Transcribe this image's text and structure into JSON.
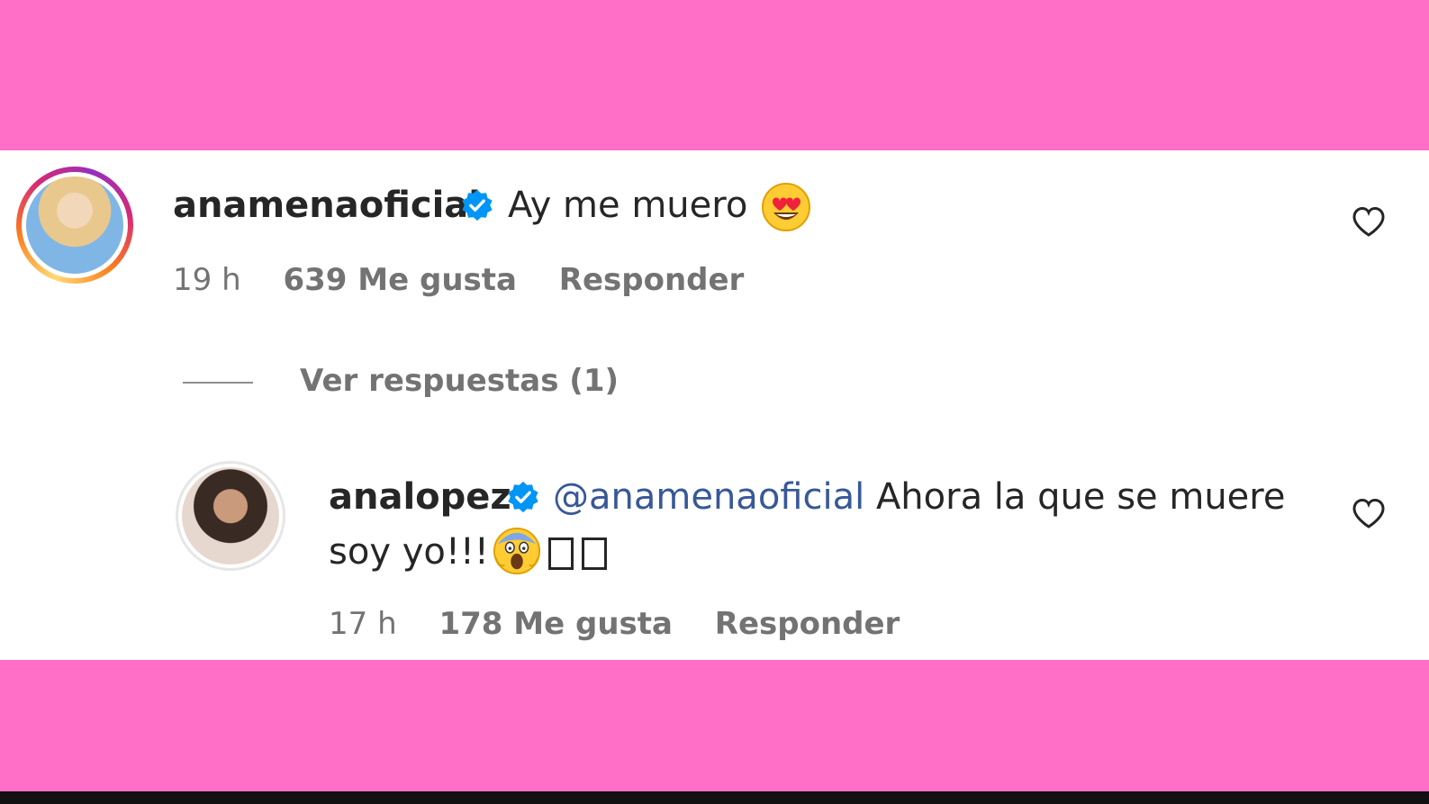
{
  "comments": [
    {
      "username": "anamenaoficial",
      "text": "Ay me muero",
      "emoji": "heart-eyes-emoji",
      "time": "19 h",
      "likes": "639 Me gusta",
      "reply": "Responder"
    },
    {
      "username": "analopez",
      "mention": "@anamenaoficial",
      "text_line1": "Ahora la que se muere",
      "text_line2": "soy yo!!!",
      "emoji": "screaming-face-emoji",
      "time": "17 h",
      "likes": "178 Me gusta",
      "reply": "Responder"
    }
  ],
  "view_replies": "Ver respuestas (1)",
  "colors": {
    "background_band": "#ff6ec7",
    "verified": "#0095f6",
    "mention": "#385898",
    "text": "#262626",
    "meta": "#737373"
  }
}
